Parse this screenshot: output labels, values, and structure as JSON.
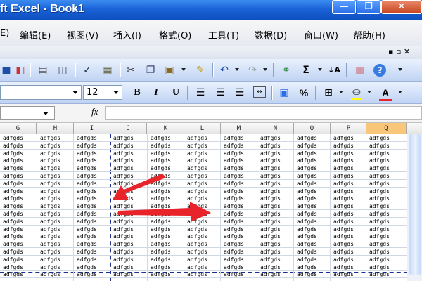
{
  "window": {
    "title": "ft Excel - Book1",
    "controls": {
      "minimize": "—",
      "restore": "❐",
      "close": "✕"
    }
  },
  "menu": {
    "items": [
      "E)",
      "编辑(E)",
      "视图(V)",
      "插入(I)",
      "格式(O)",
      "工具(T)",
      "数据(D)",
      "窗口(W)",
      "帮助(H)"
    ],
    "doc_controls": "▪ ▫ ✕"
  },
  "formatting": {
    "font_size": "12",
    "bold": "B",
    "italic": "I",
    "underline": "U",
    "percent": "%",
    "font_color_letter": "A"
  },
  "formula_bar": {
    "fx": "fx",
    "name_box": ""
  },
  "columns": [
    "G",
    "H",
    "I",
    "J",
    "K",
    "L",
    "M",
    "N",
    "O",
    "P",
    "Q"
  ],
  "active_column": "Q",
  "cell_text": "adfgds",
  "colors": {
    "titlebar": "#1b63d8",
    "pagebreak": "#1f2f8f",
    "arrow": "#e8242a",
    "active_header": "#f9c77a"
  },
  "icons": {
    "sum": "Σ",
    "sort": "↓A",
    "help": "?"
  }
}
